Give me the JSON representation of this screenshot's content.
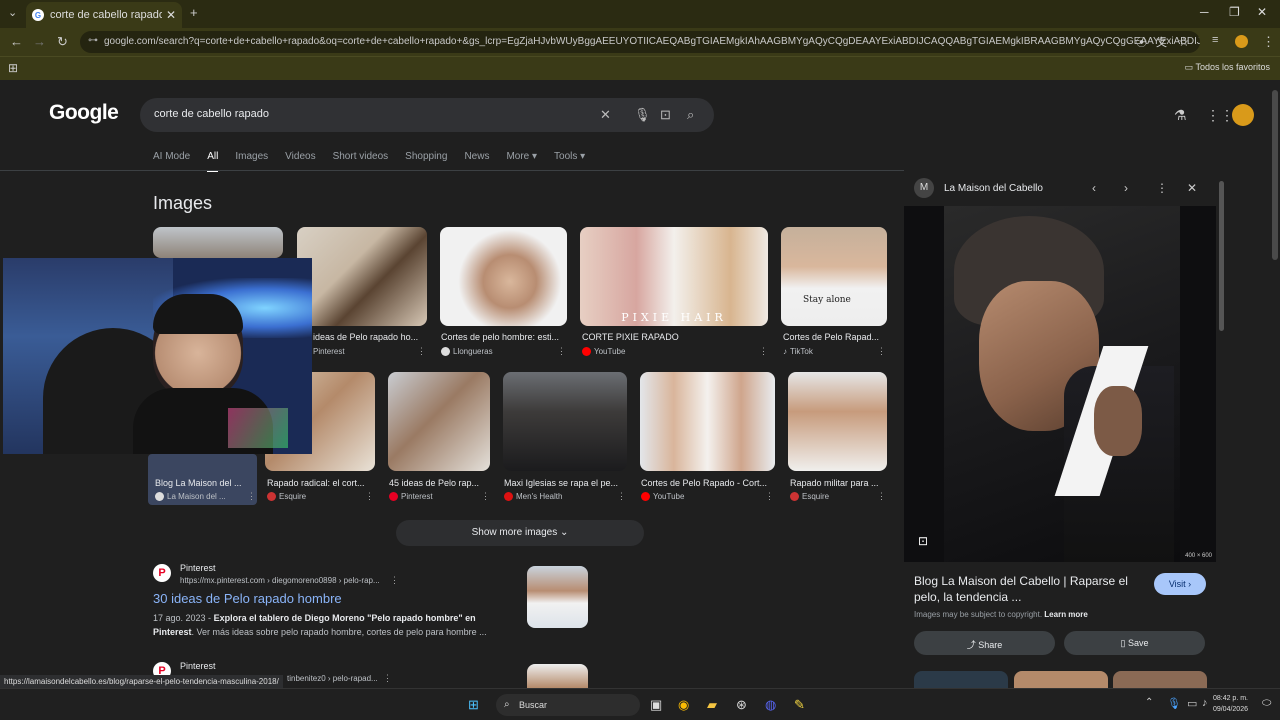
{
  "browser": {
    "tab_title": "corte de cabello rapado - Goog",
    "url": "google.com/search?q=corte+de+cabello+rapado&oq=corte+de+cabello+rapado+&gs_lcrp=EgZjaHJvbWUyBggAEEUYOTIICAEQABgTGIAEMgkIAhAAGBMYgAQyCQgDEAAYExiABDIJCAQQABgTGIAEMgkIBRAAGBMYgAQyCQgGEAAYExiABDIJCAcQA...",
    "bookmarks_label": "Todos los favoritos"
  },
  "google": {
    "logo": "Google",
    "query": "corte de cabello rapado",
    "tabs": [
      "AI Mode",
      "All",
      "Images",
      "Videos",
      "Short videos",
      "Shopping",
      "News",
      "More ▾",
      "Tools ▾"
    ],
    "images_heading": "Images",
    "row1": [
      {
        "title": "",
        "source": ""
      },
      {
        "title": "ideas de Pelo rapado ho...",
        "source": "Pinterest"
      },
      {
        "title": "Cortes de pelo hombre: esti...",
        "source": "Llongueras"
      },
      {
        "title": "CORTE PIXIE RAPADO",
        "source": "YouTube"
      },
      {
        "title": "Cortes de Pelo Rapad...",
        "source": "TikTok"
      }
    ],
    "row2": [
      {
        "title": "Blog La Maison del ...",
        "source": "La Maison del ..."
      },
      {
        "title": "Rapado radical: el cort...",
        "source": "Esquire"
      },
      {
        "title": "45 ideas de Pelo rap...",
        "source": "Pinterest"
      },
      {
        "title": "Maxi Iglesias se rapa el pe...",
        "source": "Men's Health"
      },
      {
        "title": "Cortes de Pelo Rapado - Cort...",
        "source": "YouTube"
      },
      {
        "title": "Rapado militar para ...",
        "source": "Esquire"
      }
    ],
    "pixie_overlay": "PIXIE HAIR",
    "tiktok_shirt": "Stay alone",
    "show_more": "Show more images ⌄",
    "results": [
      {
        "site": "Pinterest",
        "url": "https://mx.pinterest.com › diegomoreno0898 › pelo-rap...",
        "title": "30 ideas de Pelo rapado hombre",
        "date": "17 ago. 2023 - ",
        "snippet_bold": "Explora el tablero de Diego Moreno \"Pelo rapado hombre\" en Pinterest",
        "snippet": ". Ver más ideas sobre pelo rapado hombre, cortes de pelo para hombre ..."
      },
      {
        "site": "Pinterest",
        "url": "tinbenitez0 › pelo-rapad..."
      }
    ],
    "status_url": "https://lamaisondelcabello.es/blog/raparse-el-pelo-tendencia-masculina-2018/"
  },
  "panel": {
    "site_initial": "M",
    "site_name": "La Maison del Cabello",
    "dimensions": "400 × 600",
    "title": "Blog La Maison del Cabello | Raparse el pelo, la tendencia ...",
    "visit": "Visit ›",
    "copyright": "Images may be subject to copyright.",
    "learn_more": "Learn more",
    "share": "Share",
    "save": "Save"
  },
  "taskbar": {
    "search": "Buscar",
    "time": "08:42 p. m.",
    "date": "09/04/2026"
  },
  "colors": {
    "page_bg": "#1f1f1f",
    "link": "#8ab4f8",
    "chrome": "#3a3a17",
    "visit_bg": "#a8c7fa"
  }
}
